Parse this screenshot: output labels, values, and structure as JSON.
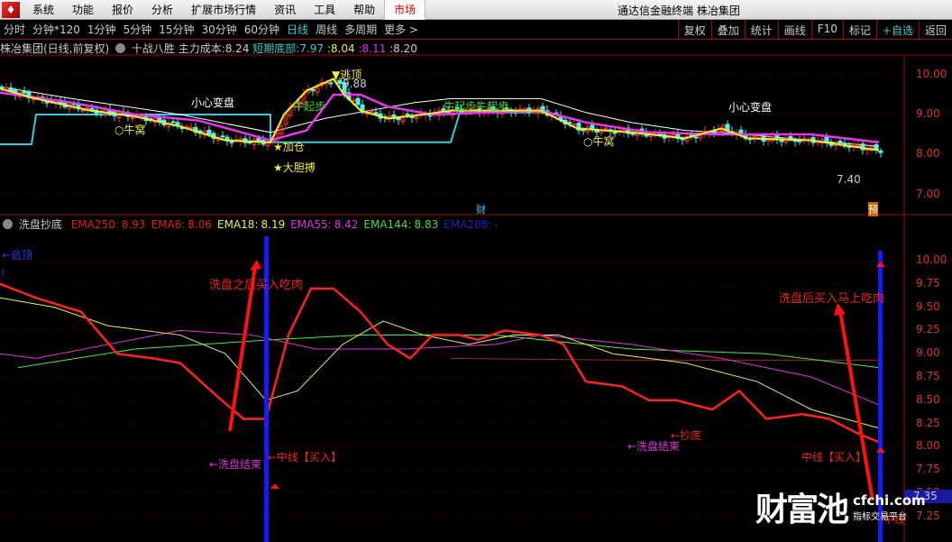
{
  "menu": {
    "logo": "♦",
    "items": [
      "系统",
      "功能",
      "报价",
      "分析",
      "扩展市场行情",
      "资讯",
      "工具",
      "帮助"
    ],
    "market": "市场",
    "window_title": "通达信金融终端  株冶集团"
  },
  "periods": [
    "分时",
    "分钟*120",
    "1分钟",
    "5分钟",
    "15分钟",
    "30分钟",
    "60分钟",
    "日线",
    "周线",
    "多周期",
    "更多 >"
  ],
  "active_period": "日线",
  "right_buttons": [
    "复权",
    "叠加",
    "统计",
    "画线",
    "F10",
    "标记",
    "+自选",
    "返回"
  ],
  "main_chart": {
    "title": "株冶集团(日线,前复权)",
    "indicator": "十战八胜",
    "cost_label": "主力成本:",
    "cost_value": "8.24",
    "bottom_label": "短期底部:",
    "bottom_values": [
      "7.97",
      ":8.04",
      ":8.11",
      ":8.20"
    ],
    "axis": [
      "10.00",
      "9.00",
      "8.00",
      "7.00"
    ],
    "annotations": {
      "caution1": "小心变盘",
      "caution2": "小心变盘",
      "escape": "▼逃顶",
      "high": "9.88",
      "bull1": "牛起步",
      "bull2": "牛起步牛起步",
      "nest1": "○牛窝",
      "nest2": "○牛窝",
      "add": "★加仓",
      "bold": "★大胆搏",
      "low": "7.40",
      "fin": "财",
      "pre": "预"
    },
    "series": {
      "price": [
        [
          0,
          9.65
        ],
        [
          8,
          9.4
        ],
        [
          20,
          9.1
        ],
        [
          30,
          8.95
        ],
        [
          40,
          8.7
        ],
        [
          50,
          8.35
        ],
        [
          60,
          8.3
        ],
        [
          63,
          9.0
        ],
        [
          68,
          9.6
        ],
        [
          74,
          9.9
        ],
        [
          76,
          9.55
        ],
        [
          80,
          9.1
        ],
        [
          86,
          8.9
        ],
        [
          94,
          9.0
        ],
        [
          100,
          9.1
        ],
        [
          120,
          9.1
        ],
        [
          128,
          8.65
        ],
        [
          140,
          8.55
        ],
        [
          152,
          8.4
        ],
        [
          160,
          8.65
        ],
        [
          166,
          8.4
        ],
        [
          180,
          8.35
        ],
        [
          195,
          8.1
        ]
      ],
      "ma_magenta": [
        [
          0,
          9.55
        ],
        [
          16,
          9.3
        ],
        [
          30,
          9.0
        ],
        [
          44,
          8.85
        ],
        [
          60,
          8.35
        ],
        [
          68,
          8.6
        ],
        [
          74,
          9.5
        ],
        [
          80,
          9.5
        ],
        [
          86,
          9.2
        ],
        [
          96,
          9.0
        ],
        [
          120,
          9.1
        ],
        [
          130,
          8.8
        ],
        [
          144,
          8.55
        ],
        [
          160,
          8.5
        ],
        [
          180,
          8.5
        ],
        [
          195,
          8.3
        ]
      ],
      "ma_white": [
        [
          0,
          9.7
        ],
        [
          16,
          9.4
        ],
        [
          40,
          9.0
        ],
        [
          60,
          8.55
        ],
        [
          72,
          8.9
        ],
        [
          92,
          9.3
        ],
        [
          100,
          9.4
        ],
        [
          120,
          9.4
        ],
        [
          130,
          9.05
        ],
        [
          140,
          8.8
        ],
        [
          152,
          8.6
        ],
        [
          160,
          8.55
        ],
        [
          180,
          8.35
        ],
        [
          195,
          8.2
        ]
      ],
      "support_cyan": [
        [
          0,
          8.25
        ],
        [
          7,
          8.25
        ],
        [
          8,
          9.0
        ],
        [
          60,
          9.0
        ],
        [
          60,
          8.3
        ],
        [
          100,
          8.3
        ],
        [
          102,
          9.05
        ],
        [
          122,
          9.05
        ]
      ]
    }
  },
  "sub_chart": {
    "title": "洗盘抄底",
    "legend": [
      {
        "name": "EMA250:",
        "value": "8.93",
        "color": "#e02020"
      },
      {
        "name": "EMA6:",
        "value": "8.06",
        "color": "#e02020"
      },
      {
        "name": "EMA18:",
        "value": "8.19",
        "color": "#f0f040"
      },
      {
        "name": "EMA55:",
        "value": "8.42",
        "color": "#e030e0"
      },
      {
        "name": "EMA144:",
        "value": "8.83",
        "color": "#40e040"
      },
      {
        "name": "EMA288:",
        "value": "-",
        "color": "#2020c0"
      }
    ],
    "axis": [
      "10.00",
      "9.75",
      "9.50",
      "9.25",
      "9.00",
      "8.75",
      "8.50",
      "8.25",
      "8.00",
      "7.75",
      "7.50",
      "7.25"
    ],
    "annotations": {
      "escape": "←逃顶",
      "note1": "洗盘之后买入吃肉",
      "note2": "洗盘后买入马上吃肉",
      "wash1": "←洗盘结束",
      "wash2": "←洗盘结束",
      "mid1": "←中线【买入】",
      "mid2": "中线【买入】",
      "bottom": "←抄底",
      "mid3": "中线",
      "last": "7.35"
    },
    "series": {
      "ema6": [
        [
          0,
          9.75
        ],
        [
          8,
          9.6
        ],
        [
          18,
          9.45
        ],
        [
          26,
          9.0
        ],
        [
          34,
          8.95
        ],
        [
          40,
          8.9
        ],
        [
          48,
          8.55
        ],
        [
          54,
          8.3
        ],
        [
          59,
          8.3
        ],
        [
          64,
          9.2
        ],
        [
          69,
          9.7
        ],
        [
          74,
          9.7
        ],
        [
          80,
          9.45
        ],
        [
          86,
          9.1
        ],
        [
          91,
          8.95
        ],
        [
          96,
          9.2
        ],
        [
          102,
          9.2
        ],
        [
          106,
          9.15
        ],
        [
          112,
          9.25
        ],
        [
          120,
          9.2
        ],
        [
          125,
          9.1
        ],
        [
          130,
          8.7
        ],
        [
          138,
          8.65
        ],
        [
          144,
          8.5
        ],
        [
          150,
          8.5
        ],
        [
          158,
          8.4
        ],
        [
          164,
          8.6
        ],
        [
          170,
          8.3
        ],
        [
          178,
          8.35
        ],
        [
          184,
          8.3
        ],
        [
          190,
          8.15
        ],
        [
          195,
          8.05
        ]
      ],
      "ema18": [
        [
          0,
          9.6
        ],
        [
          12,
          9.5
        ],
        [
          24,
          9.3
        ],
        [
          40,
          9.2
        ],
        [
          50,
          9.0
        ],
        [
          59,
          8.5
        ],
        [
          66,
          8.6
        ],
        [
          76,
          9.1
        ],
        [
          85,
          9.35
        ],
        [
          94,
          9.2
        ],
        [
          104,
          9.1
        ],
        [
          114,
          9.2
        ],
        [
          124,
          9.2
        ],
        [
          136,
          9.0
        ],
        [
          152,
          8.9
        ],
        [
          168,
          8.7
        ],
        [
          180,
          8.4
        ],
        [
          195,
          8.2
        ]
      ],
      "ema55": [
        [
          0,
          9.0
        ],
        [
          8,
          8.95
        ],
        [
          24,
          9.1
        ],
        [
          40,
          9.25
        ],
        [
          56,
          9.2
        ],
        [
          70,
          9.05
        ],
        [
          90,
          9.05
        ],
        [
          110,
          9.1
        ],
        [
          120,
          9.2
        ],
        [
          140,
          9.1
        ],
        [
          160,
          8.95
        ],
        [
          180,
          8.75
        ],
        [
          195,
          8.45
        ]
      ],
      "ema144": [
        [
          4,
          8.85
        ],
        [
          30,
          9.05
        ],
        [
          60,
          9.15
        ],
        [
          80,
          9.2
        ],
        [
          110,
          9.2
        ],
        [
          140,
          9.05
        ],
        [
          170,
          9.0
        ],
        [
          195,
          8.85
        ]
      ],
      "ema250": [
        [
          100,
          8.95
        ],
        [
          140,
          8.93
        ],
        [
          195,
          8.93
        ]
      ]
    }
  },
  "watermark": {
    "brand": "财富池",
    "domain": "cfchi.com",
    "slogan": "指标交易平台"
  }
}
